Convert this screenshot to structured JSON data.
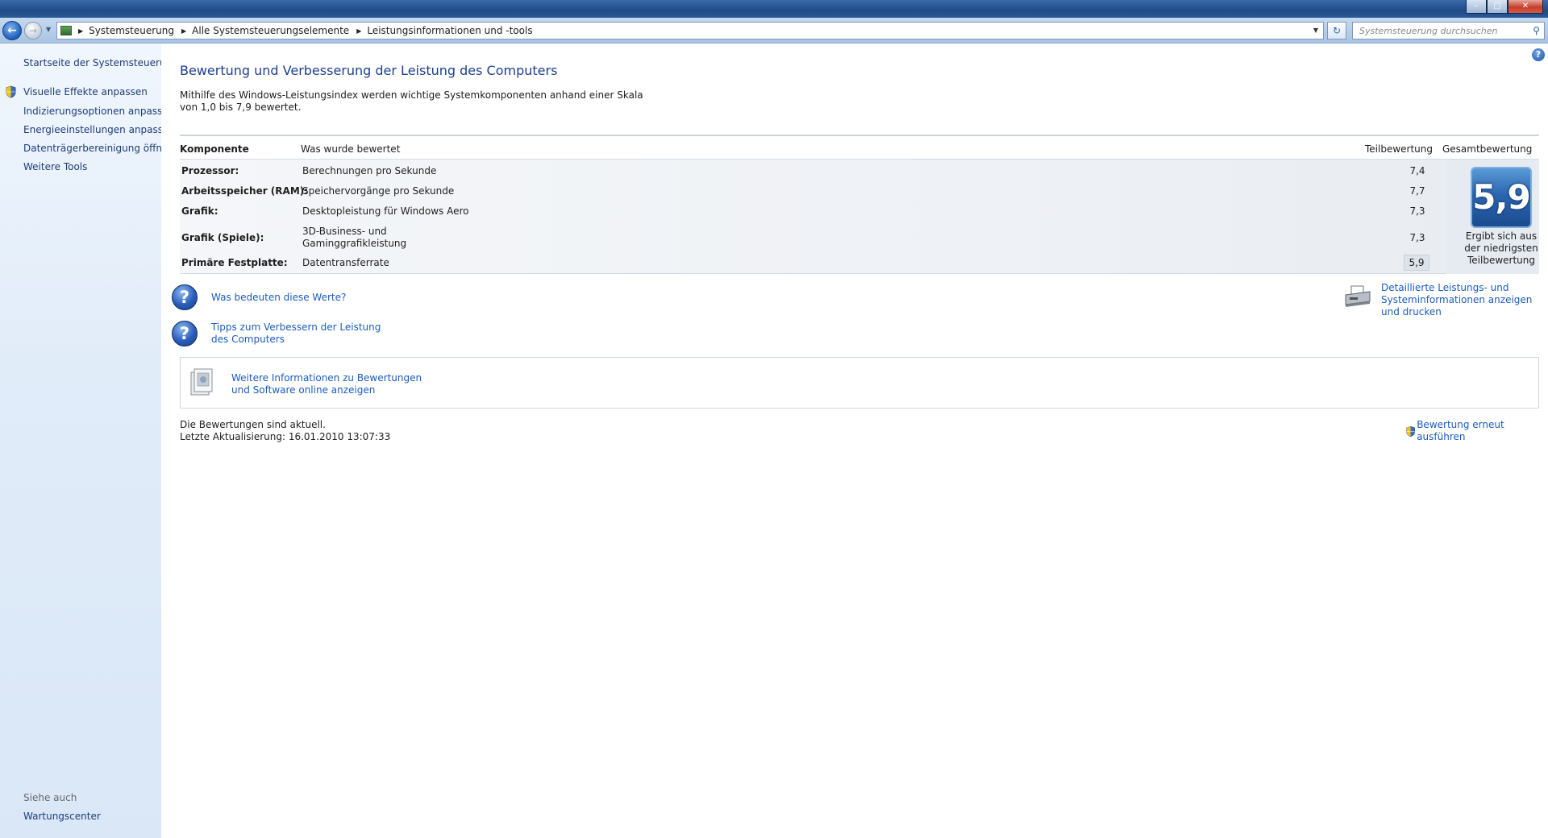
{
  "window": {
    "title": "",
    "controls": {
      "minimize_icon": "minimize-icon",
      "maximize_icon": "maximize-icon",
      "close_icon": "close-icon"
    }
  },
  "navigation": {
    "back_icon": "arrow-left-icon",
    "forward_icon": "arrow-right-icon",
    "breadcrumb": [
      "Systemsteuerung",
      "Alle Systemsteuerungselemente",
      "Leistungsinformationen und -tools"
    ],
    "search_placeholder": "Systemsteuerung durchsuchen"
  },
  "sidebar": {
    "home": "Startseite der Systemsteuerung",
    "items": [
      {
        "label": "Visuelle Effekte anpassen",
        "shield": true
      },
      {
        "label": "Indizierungsoptionen anpassen",
        "shield": false
      },
      {
        "label": "Energieeinstellungen anpassen",
        "shield": false
      },
      {
        "label": "Datenträgerbereinigung öffnen",
        "shield": false
      },
      {
        "label": "Weitere Tools",
        "shield": false
      }
    ],
    "see_also_heading": "Siehe auch",
    "see_also": [
      "Wartungscenter"
    ]
  },
  "main": {
    "title": "Bewertung und Verbesserung der Leistung des Computers",
    "intro": "Mithilfe des Windows-Leistungsindex werden wichtige Systemkomponenten anhand einer Skala von 1,0 bis 7,9 bewertet.",
    "table": {
      "headers": [
        "Komponente",
        "Was wurde bewertet",
        "Teilbewertung",
        "Gesamtbewertung"
      ],
      "rows": [
        {
          "component": "Prozessor:",
          "what": "Berechnungen pro Sekunde",
          "score": "7,4"
        },
        {
          "component": "Arbeitsspeicher (RAM):",
          "what": "Speichervorgänge pro Sekunde",
          "score": "7,7"
        },
        {
          "component": "Grafik:",
          "what": "Desktopleistung für Windows Aero",
          "score": "7,3"
        },
        {
          "component": "Grafik (Spiele):",
          "what": "3D-Business- und Gaminggrafikleistung",
          "score": "7,3"
        },
        {
          "component": "Primäre Festplatte:",
          "what": "Datentransferrate",
          "score": "5,9"
        }
      ],
      "base_score": "5,9",
      "base_caption": "Ergibt sich aus der niedrigsten Teilbewertung"
    },
    "help_links": [
      {
        "label": "Was bedeuten diese Werte?",
        "icon": "question-icon"
      },
      {
        "label": "Tipps zum Verbessern der Leistung des Computers",
        "icon": "question-icon"
      }
    ],
    "details_link": "Detaillierte Leistungs- und Systeminformationen anzeigen und drucken",
    "info_box_link": "Weitere Informationen zu Bewertungen und Software online anzeigen",
    "status": "Die Bewertungen sind aktuell.",
    "last_update": "Letzte Aktualisierung: 16.01.2010 13:07:33",
    "rerun": "Bewertung erneut ausführen"
  },
  "colors": {
    "link": "#1b5cbf",
    "title": "#1e3f8c",
    "sidebar_link": "#1e3c78",
    "badge": "#2c66b0"
  }
}
